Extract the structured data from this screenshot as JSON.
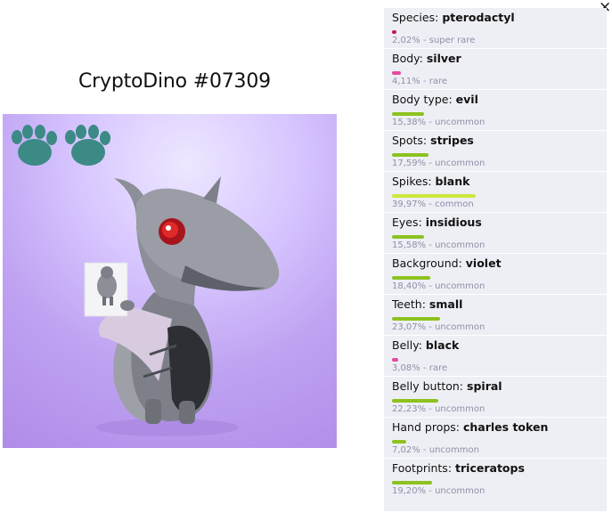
{
  "title": "CryptoDino #07309",
  "close_label": "×",
  "colors": {
    "super_rare": "#c2185b",
    "rare": "#e64a9f",
    "uncommon": "#8dc21f",
    "common": "#cde73a",
    "dino_body": "#7d8089",
    "footprint": "#3c8a86",
    "background": "#c4a8f5"
  },
  "traits": [
    {
      "label": "Species:",
      "value": "pterodactyl",
      "percent": 2.02,
      "info": "2,02% - super rare",
      "rarity": "super_rare"
    },
    {
      "label": "Body:",
      "value": "silver",
      "percent": 4.11,
      "info": "4,11% - rare",
      "rarity": "rare"
    },
    {
      "label": "Body type:",
      "value": "evil",
      "percent": 15.38,
      "info": "15,38% - uncommon",
      "rarity": "uncommon"
    },
    {
      "label": "Spots:",
      "value": "stripes",
      "percent": 17.59,
      "info": "17,59% - uncommon",
      "rarity": "uncommon"
    },
    {
      "label": "Spikes:",
      "value": "blank",
      "percent": 39.97,
      "info": "39,97% - common",
      "rarity": "common"
    },
    {
      "label": "Eyes:",
      "value": "insidious",
      "percent": 15.58,
      "info": "15,58% - uncommon",
      "rarity": "uncommon"
    },
    {
      "label": "Background:",
      "value": "violet",
      "percent": 18.4,
      "info": "18,40% - uncommon",
      "rarity": "uncommon"
    },
    {
      "label": "Teeth:",
      "value": "small",
      "percent": 23.07,
      "info": "23,07% - uncommon",
      "rarity": "uncommon"
    },
    {
      "label": "Belly:",
      "value": "black",
      "percent": 3.08,
      "info": "3,08% - rare",
      "rarity": "rare"
    },
    {
      "label": "Belly button:",
      "value": "spiral",
      "percent": 22.23,
      "info": "22,23% - uncommon",
      "rarity": "uncommon"
    },
    {
      "label": "Hand props:",
      "value": "charles token",
      "percent": 7.02,
      "info": "7,02% - uncommon",
      "rarity": "uncommon"
    },
    {
      "label": "Footprints:",
      "value": "triceratops",
      "percent": 19.2,
      "info": "19,20% - uncommon",
      "rarity": "uncommon"
    }
  ]
}
